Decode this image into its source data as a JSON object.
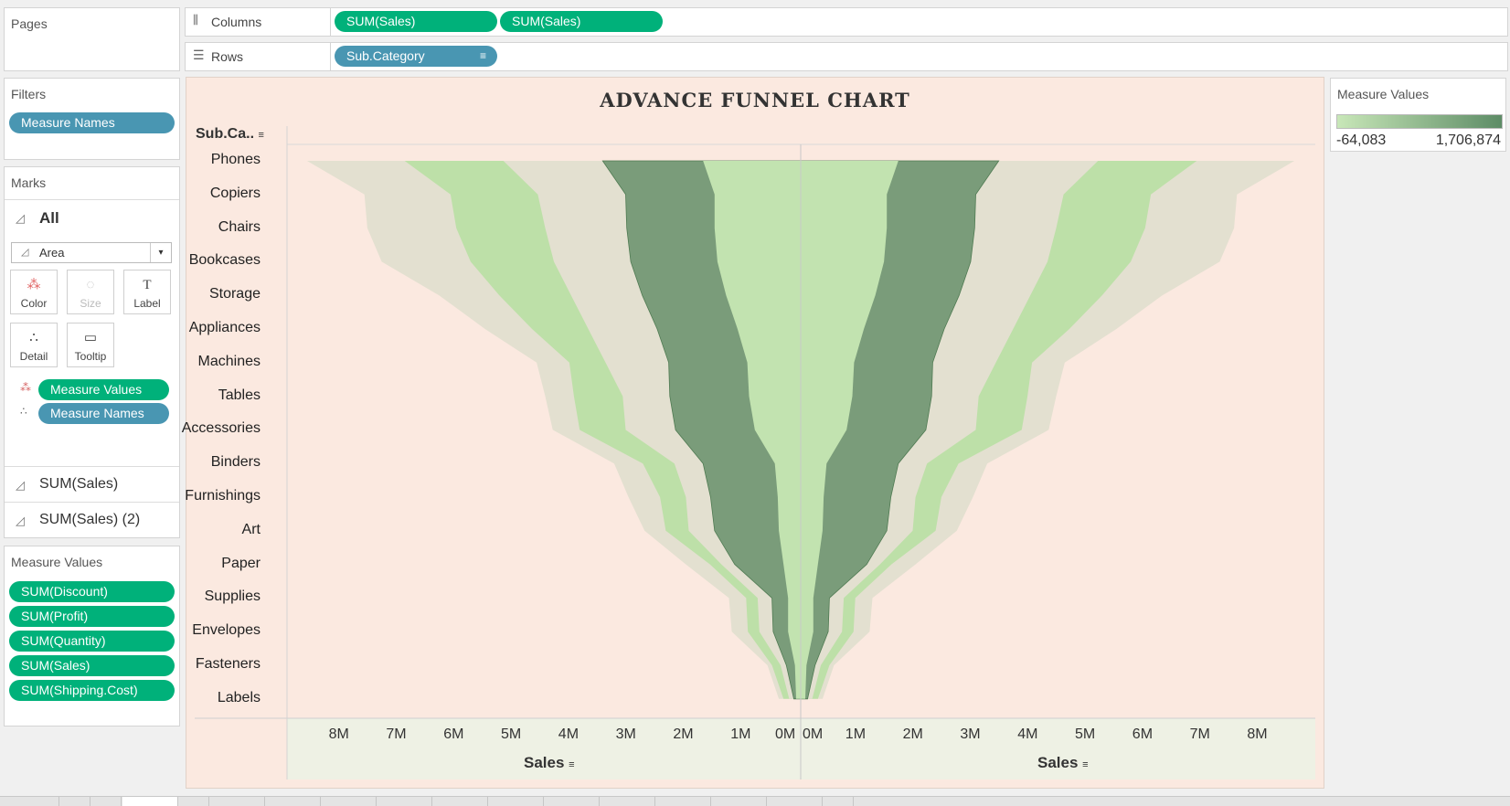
{
  "pages_card": {
    "title": "Pages"
  },
  "columns_shelf": {
    "label": "Columns",
    "pills": [
      "SUM(Sales)",
      "SUM(Sales)"
    ]
  },
  "rows_shelf": {
    "label": "Rows",
    "pills": [
      "Sub.Category"
    ]
  },
  "filters_card": {
    "title": "Filters",
    "pills": [
      "Measure Names"
    ]
  },
  "marks_card": {
    "title": "Marks",
    "all_label": "All",
    "mark_type": "Area",
    "buttons": {
      "color": "Color",
      "size": "Size",
      "label": "Label",
      "detail": "Detail",
      "tooltip": "Tooltip"
    },
    "encodings": [
      {
        "label": "Measure Values",
        "icon": "color-dots-icon"
      },
      {
        "label": "Measure Names",
        "icon": "detail-dots-icon"
      }
    ],
    "panes": [
      "SUM(Sales)",
      "SUM(Sales) (2)"
    ]
  },
  "measure_values_card": {
    "title": "Measure Values",
    "pills": [
      "SUM(Discount)",
      "SUM(Profit)",
      "SUM(Quantity)",
      "SUM(Sales)",
      "SUM(Shipping.Cost)"
    ]
  },
  "legend": {
    "title": "Measure Values",
    "min": "-64,083",
    "max": "1,706,874",
    "colors": [
      "#c8e7b8",
      "#5d8c66"
    ]
  },
  "chart_data": {
    "type": "area",
    "title": "ADVANCE FUNNEL CHART",
    "row_header": "Sub.Ca..",
    "xlabel": "Sales",
    "left_ticks": [
      "8M",
      "7M",
      "6M",
      "5M",
      "4M",
      "3M",
      "2M",
      "1M",
      "0M"
    ],
    "right_ticks": [
      "0M",
      "1M",
      "2M",
      "3M",
      "4M",
      "5M",
      "6M",
      "7M",
      "8M"
    ],
    "xlim": [
      0,
      8.8
    ],
    "categories": [
      "Phones",
      "Copiers",
      "Chairs",
      "Bookcases",
      "Storage",
      "Appliances",
      "Machines",
      "Tables",
      "Accessories",
      "Binders",
      "Furnishings",
      "Art",
      "Paper",
      "Supplies",
      "Envelopes",
      "Fasteners",
      "Labels"
    ],
    "cumulative_millions": [
      [
        1.7,
        3.45,
        5.18,
        6.9,
        8.6
      ],
      [
        1.5,
        3.05,
        4.58,
        6.1,
        7.6
      ],
      [
        1.5,
        3.03,
        4.45,
        6.0,
        7.55
      ],
      [
        1.45,
        2.96,
        4.3,
        5.75,
        7.3
      ],
      [
        1.3,
        2.76,
        4.0,
        5.25,
        6.3
      ],
      [
        1.1,
        2.5,
        3.7,
        4.68,
        5.5
      ],
      [
        0.93,
        2.3,
        3.4,
        4.03,
        4.6
      ],
      [
        0.9,
        2.28,
        3.1,
        3.95,
        4.45
      ],
      [
        0.8,
        2.18,
        3.05,
        3.85,
        4.32
      ],
      [
        0.45,
        1.7,
        2.2,
        2.75,
        3.25
      ],
      [
        0.4,
        1.57,
        2.0,
        2.45,
        3.0
      ],
      [
        0.38,
        1.5,
        1.95,
        2.35,
        2.72
      ],
      [
        0.3,
        1.15,
        1.38,
        1.58,
        2.0
      ],
      [
        0.22,
        0.5,
        0.75,
        0.95,
        1.25
      ],
      [
        0.22,
        0.48,
        0.72,
        0.92,
        1.2
      ],
      [
        0.1,
        0.25,
        0.35,
        0.5,
        0.58
      ],
      [
        0.08,
        0.12,
        0.2,
        0.3,
        0.38
      ]
    ],
    "band_colors": [
      "#c2e3b0",
      "#7a9c7a",
      "#e3e0d0",
      "#bde0a8",
      "#e3e0d0"
    ]
  }
}
